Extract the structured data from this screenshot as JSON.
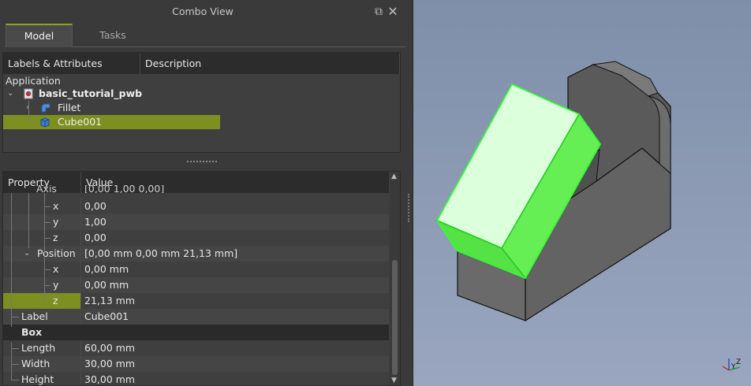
{
  "combo": {
    "title": "Combo View",
    "tabs": [
      "Model",
      "Tasks"
    ]
  },
  "tree": {
    "headers": [
      "Labels & Attributes",
      "Description"
    ],
    "application_label": "Application",
    "document": "basic_tutorial_pwb",
    "items": [
      "Fillet",
      "Cube001"
    ]
  },
  "properties": {
    "headers": [
      "Property",
      "Value"
    ],
    "partial_row": {
      "name": "Axis",
      "value": "[0,00 1,00 0,00]"
    },
    "rows": [
      {
        "name": "x",
        "value": "0,00"
      },
      {
        "name": "y",
        "value": "1,00"
      },
      {
        "name": "z",
        "value": "0,00"
      },
      {
        "name": "Position",
        "value": "[0,00 mm  0,00 mm  21,13 mm]"
      },
      {
        "name": "x",
        "value": "0,00 mm"
      },
      {
        "name": "y",
        "value": "0,00 mm"
      },
      {
        "name": "z",
        "value": "21,13 mm"
      },
      {
        "name": "Label",
        "value": "Cube001"
      },
      {
        "name": "Box",
        "value": ""
      },
      {
        "name": "Length",
        "value": "60,00 mm"
      },
      {
        "name": "Width",
        "value": "30,00 mm"
      },
      {
        "name": "Height",
        "value": "30,00 mm"
      }
    ]
  },
  "viewport": {
    "axis_labels": [
      "Y",
      "Z"
    ],
    "selection_color": "#5ee65e",
    "background_top": "#7f8fa9",
    "background_bottom": "#9aa6bf"
  }
}
